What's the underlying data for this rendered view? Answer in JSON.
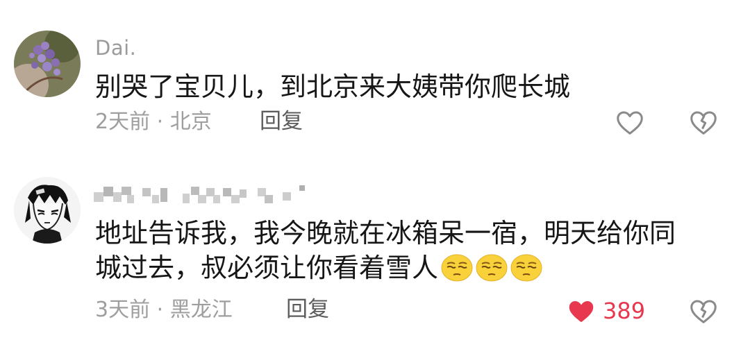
{
  "comments": [
    {
      "username": "Dai.",
      "text_lines": [
        "别哭了宝贝儿，到北京来大姨带你爬长城"
      ],
      "time": "2天前",
      "location": "北京",
      "reply_label": "回复",
      "liked": false,
      "like_count": "",
      "avatar_icon": "lilac-flowers-avatar"
    },
    {
      "username": "",
      "username_obscured": true,
      "text_lines": [
        "地址告诉我，我今晚就在冰箱呆一宿，明天给你同",
        "城过去，叔必须让你看着雪人"
      ],
      "emojis": [
        "smirk-emoji",
        "smirk-emoji",
        "smirk-emoji"
      ],
      "time": "3天前",
      "location": "黑龙江",
      "reply_label": "回复",
      "liked": true,
      "like_count": "389",
      "avatar_icon": "anime-character-avatar"
    }
  ],
  "meta_separator": " · ",
  "colors": {
    "like_active": "#e8384f",
    "meta_text": "#9e9e9e",
    "body_text": "#161616"
  }
}
